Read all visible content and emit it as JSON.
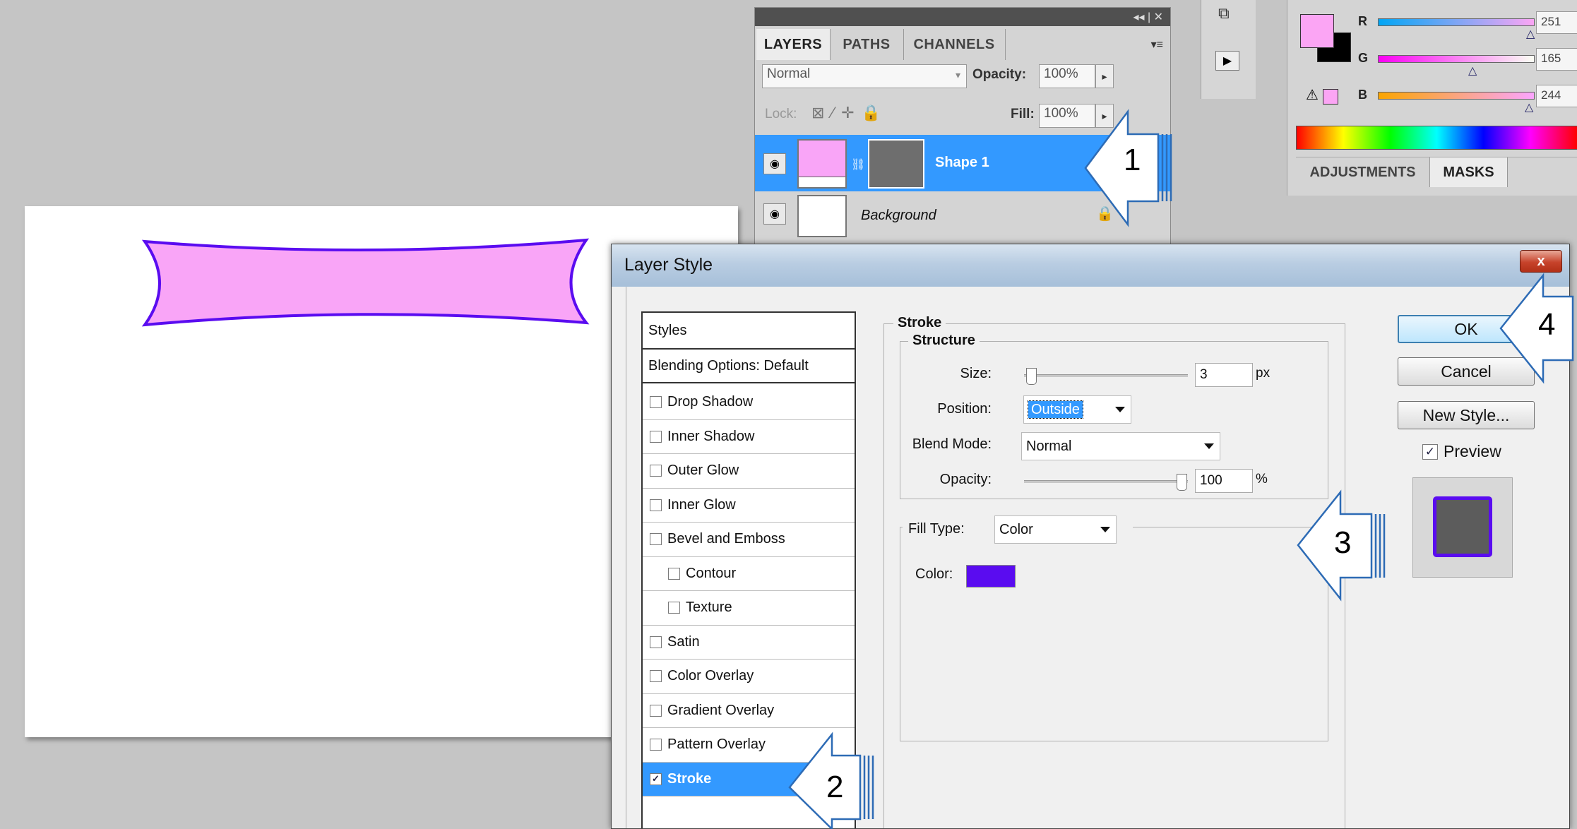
{
  "layers_panel": {
    "tabs": [
      "LAYERS",
      "PATHS",
      "CHANNELS"
    ],
    "blend_mode": "Normal",
    "opacity_label": "Opacity:",
    "opacity_value": "100%",
    "lock_label": "Lock:",
    "fill_label": "Fill:",
    "fill_value": "100%",
    "layers": [
      {
        "name": "Shape 1",
        "selected": true
      },
      {
        "name": "Background",
        "selected": false
      }
    ]
  },
  "color_panel": {
    "channels": [
      {
        "label": "R",
        "value": "251"
      },
      {
        "label": "G",
        "value": "165"
      },
      {
        "label": "B",
        "value": "244"
      }
    ],
    "foreground": "#fba5f4",
    "tabs": [
      "ADJUSTMENTS",
      "MASKS"
    ]
  },
  "dialog": {
    "title": "Layer Style",
    "close_label": "x",
    "styles_header": "Styles",
    "blending_options": "Blending Options: Default",
    "style_items": [
      {
        "label": "Drop Shadow",
        "checked": false,
        "indent": false
      },
      {
        "label": "Inner Shadow",
        "checked": false,
        "indent": false
      },
      {
        "label": "Outer Glow",
        "checked": false,
        "indent": false
      },
      {
        "label": "Inner Glow",
        "checked": false,
        "indent": false
      },
      {
        "label": "Bevel and Emboss",
        "checked": false,
        "indent": false
      },
      {
        "label": "Contour",
        "checked": false,
        "indent": true
      },
      {
        "label": "Texture",
        "checked": false,
        "indent": true
      },
      {
        "label": "Satin",
        "checked": false,
        "indent": false
      },
      {
        "label": "Color Overlay",
        "checked": false,
        "indent": false
      },
      {
        "label": "Gradient Overlay",
        "checked": false,
        "indent": false
      },
      {
        "label": "Pattern Overlay",
        "checked": false,
        "indent": false
      },
      {
        "label": "Stroke",
        "checked": true,
        "indent": false,
        "selected": true
      }
    ],
    "stroke": {
      "group_title": "Stroke",
      "structure_title": "Structure",
      "size_label": "Size:",
      "size_value": "3",
      "size_unit": "px",
      "position_label": "Position:",
      "position_value": "Outside",
      "blend_label": "Blend Mode:",
      "blend_value": "Normal",
      "opacity_label": "Opacity:",
      "opacity_value": "100",
      "opacity_unit": "%",
      "opacity_level": 1.0,
      "size_level": 0.0,
      "fill_type_label": "Fill Type:",
      "fill_type_value": "Color",
      "color_label": "Color:",
      "stroke_color": "#5a0cf0"
    },
    "buttons": {
      "ok": "OK",
      "cancel": "Cancel",
      "new_style": "New Style...",
      "preview_label": "Preview",
      "preview_checked": true
    }
  },
  "callouts": [
    "1",
    "2",
    "3",
    "4"
  ],
  "shape_fill": "#f9a5f7",
  "shape_stroke": "#5a0cf0"
}
